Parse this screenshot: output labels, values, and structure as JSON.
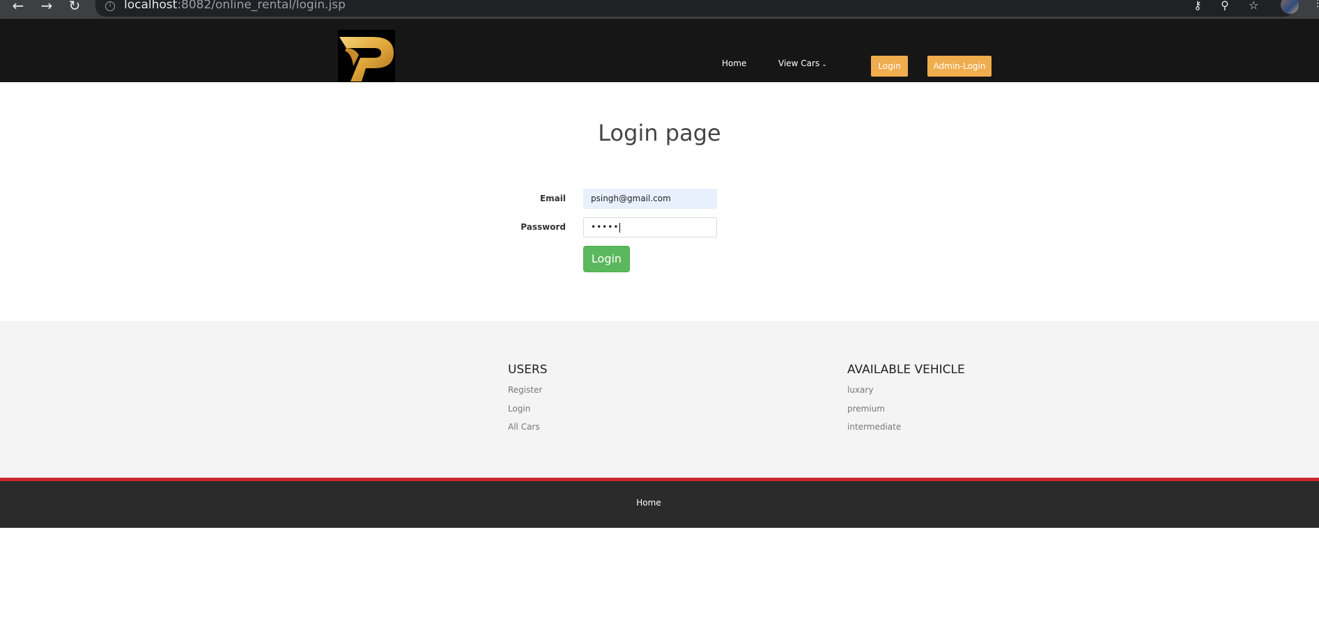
{
  "browser": {
    "url_host": "localhost",
    "url_rest": ":8082/online_rental/login.jsp"
  },
  "header": {
    "nav": {
      "home": "Home",
      "view_cars": "View Cars"
    },
    "buttons": {
      "login": "Login",
      "admin_login": "Admin-Login"
    },
    "colors": {
      "background": "#161616",
      "button": "#f0ad4e",
      "logo_gold": "#e0a83a"
    }
  },
  "main": {
    "title": "Login page",
    "email_label": "Email",
    "email_value": "psingh@gmail.com",
    "password_label": "Password",
    "password_value": "•••••",
    "submit_label": "Login",
    "submit_color": "#5cb85c"
  },
  "footer": {
    "users": {
      "title": "USERS",
      "links": [
        "Register",
        "Login",
        "All Cars"
      ]
    },
    "vehicles": {
      "title": "AVAILABLE VEHICLE",
      "links": [
        "luxary",
        "premium",
        "intermediate"
      ]
    },
    "bottom_home": "Home",
    "accent_color": "#c9262e"
  }
}
